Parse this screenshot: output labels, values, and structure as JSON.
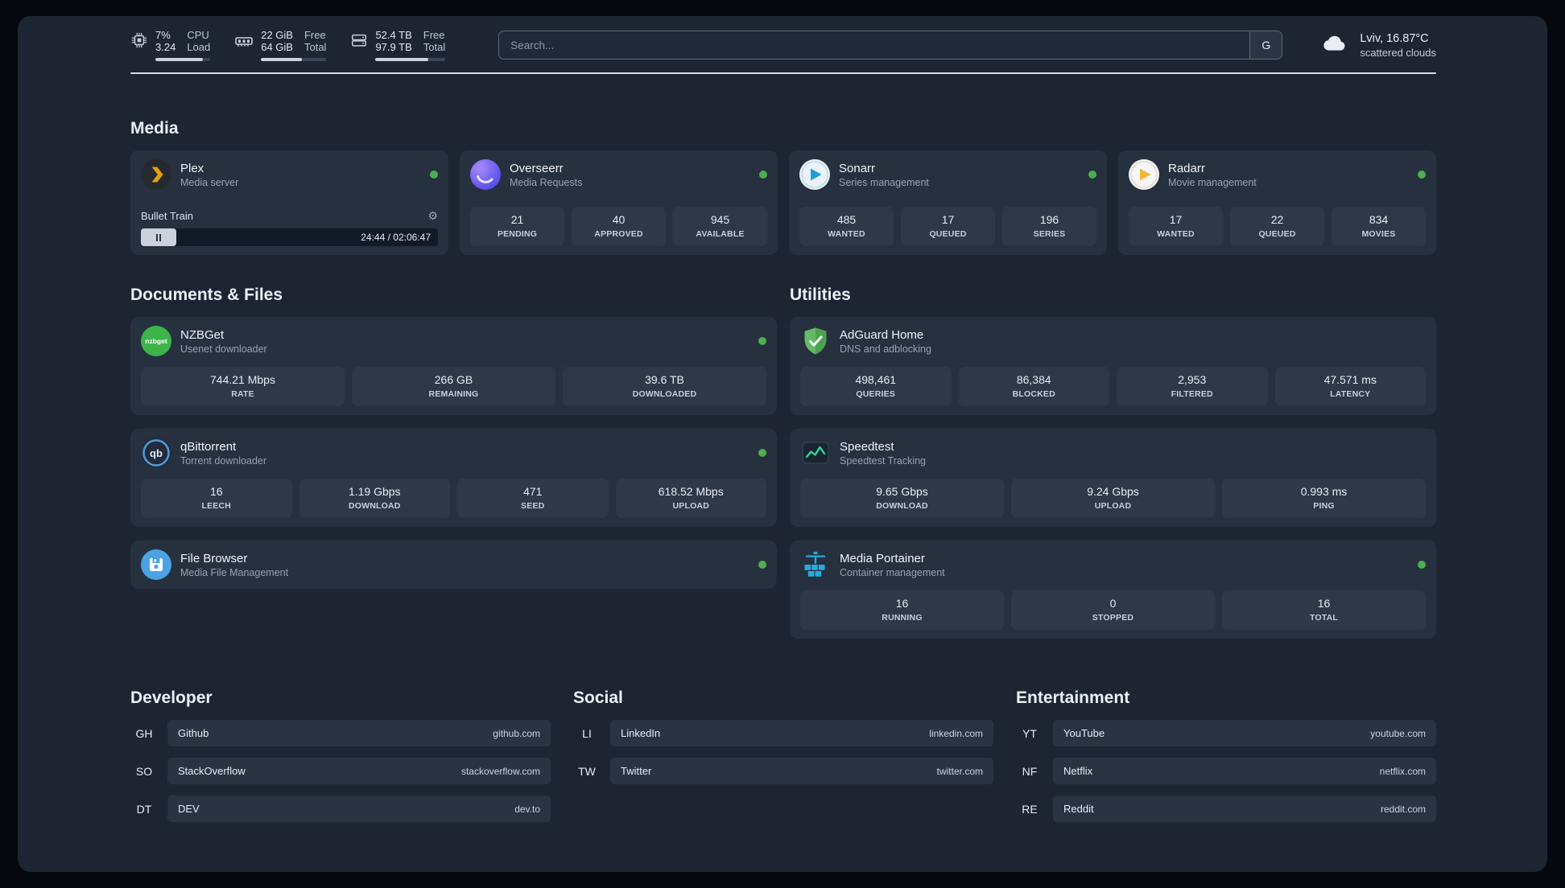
{
  "topbar": {
    "cpu": {
      "value1": "7%",
      "value2": "3.24",
      "label1": "CPU",
      "label2": "Load"
    },
    "ram": {
      "value1": "22 GiB",
      "value2": "64 GiB",
      "label1": "Free",
      "label2": "Total"
    },
    "disk": {
      "value1": "52.4 TB",
      "value2": "97.9 TB",
      "label1": "Free",
      "label2": "Total"
    },
    "search": {
      "placeholder": "Search...",
      "engine_label": "G"
    },
    "weather": {
      "location": "Lviv, 16.87°C",
      "condition": "scattered clouds"
    }
  },
  "media": {
    "title": "Media",
    "plex": {
      "name": "Plex",
      "subtitle": "Media server",
      "now_playing": "Bullet Train",
      "time": "24:44 / 02:06:47"
    },
    "overseerr": {
      "name": "Overseerr",
      "subtitle": "Media Requests",
      "stats": [
        {
          "value": "21",
          "label": "PENDING"
        },
        {
          "value": "40",
          "label": "APPROVED"
        },
        {
          "value": "945",
          "label": "AVAILABLE"
        }
      ]
    },
    "sonarr": {
      "name": "Sonarr",
      "subtitle": "Series management",
      "stats": [
        {
          "value": "485",
          "label": "WANTED"
        },
        {
          "value": "17",
          "label": "QUEUED"
        },
        {
          "value": "196",
          "label": "SERIES"
        }
      ]
    },
    "radarr": {
      "name": "Radarr",
      "subtitle": "Movie management",
      "stats": [
        {
          "value": "17",
          "label": "WANTED"
        },
        {
          "value": "22",
          "label": "QUEUED"
        },
        {
          "value": "834",
          "label": "MOVIES"
        }
      ]
    }
  },
  "documents": {
    "title": "Documents & Files",
    "nzbget": {
      "name": "NZBGet",
      "subtitle": "Usenet downloader",
      "stats": [
        {
          "value": "744.21 Mbps",
          "label": "RATE"
        },
        {
          "value": "266 GB",
          "label": "REMAINING"
        },
        {
          "value": "39.6 TB",
          "label": "DOWNLOADED"
        }
      ]
    },
    "qbittorrent": {
      "name": "qBittorrent",
      "subtitle": "Torrent downloader",
      "stats": [
        {
          "value": "16",
          "label": "LEECH"
        },
        {
          "value": "1.19 Gbps",
          "label": "DOWNLOAD"
        },
        {
          "value": "471",
          "label": "SEED"
        },
        {
          "value": "618.52 Mbps",
          "label": "UPLOAD"
        }
      ]
    },
    "filebrowser": {
      "name": "File Browser",
      "subtitle": "Media File Management"
    }
  },
  "utilities": {
    "title": "Utilities",
    "adguard": {
      "name": "AdGuard Home",
      "subtitle": "DNS and adblocking",
      "stats": [
        {
          "value": "498,461",
          "label": "QUERIES"
        },
        {
          "value": "86,384",
          "label": "BLOCKED"
        },
        {
          "value": "2,953",
          "label": "FILTERED"
        },
        {
          "value": "47.571 ms",
          "label": "LATENCY"
        }
      ]
    },
    "speedtest": {
      "name": "Speedtest",
      "subtitle": "Speedtest Tracking",
      "stats": [
        {
          "value": "9.65 Gbps",
          "label": "DOWNLOAD"
        },
        {
          "value": "9.24 Gbps",
          "label": "UPLOAD"
        },
        {
          "value": "0.993 ms",
          "label": "PING"
        }
      ]
    },
    "portainer": {
      "name": "Media Portainer",
      "subtitle": "Container management",
      "stats": [
        {
          "value": "16",
          "label": "RUNNING"
        },
        {
          "value": "0",
          "label": "STOPPED"
        },
        {
          "value": "16",
          "label": "TOTAL"
        }
      ]
    }
  },
  "bookmarks": {
    "developer": {
      "title": "Developer",
      "items": [
        {
          "abbr": "GH",
          "name": "Github",
          "url": "github.com"
        },
        {
          "abbr": "SO",
          "name": "StackOverflow",
          "url": "stackoverflow.com"
        },
        {
          "abbr": "DT",
          "name": "DEV",
          "url": "dev.to"
        }
      ]
    },
    "social": {
      "title": "Social",
      "items": [
        {
          "abbr": "LI",
          "name": "LinkedIn",
          "url": "linkedin.com"
        },
        {
          "abbr": "TW",
          "name": "Twitter",
          "url": "twitter.com"
        }
      ]
    },
    "entertainment": {
      "title": "Entertainment",
      "items": [
        {
          "abbr": "YT",
          "name": "YouTube",
          "url": "youtube.com"
        },
        {
          "abbr": "NF",
          "name": "Netflix",
          "url": "netflix.com"
        },
        {
          "abbr": "RE",
          "name": "Reddit",
          "url": "reddit.com"
        }
      ]
    }
  },
  "icons": {
    "gear": "⚙",
    "nzbget_text": "nzbget",
    "qbittorrent_text": "qb"
  },
  "colors": {
    "background": "#1d2533",
    "card": "#27303f",
    "stat_tile": "#2e3849",
    "status_online": "#4caf50",
    "plex_amber": "#e5a00d",
    "adguard_green": "#52b154",
    "portainer_blue": "#29a8e0",
    "speedtest_green": "#2bd9a0"
  }
}
